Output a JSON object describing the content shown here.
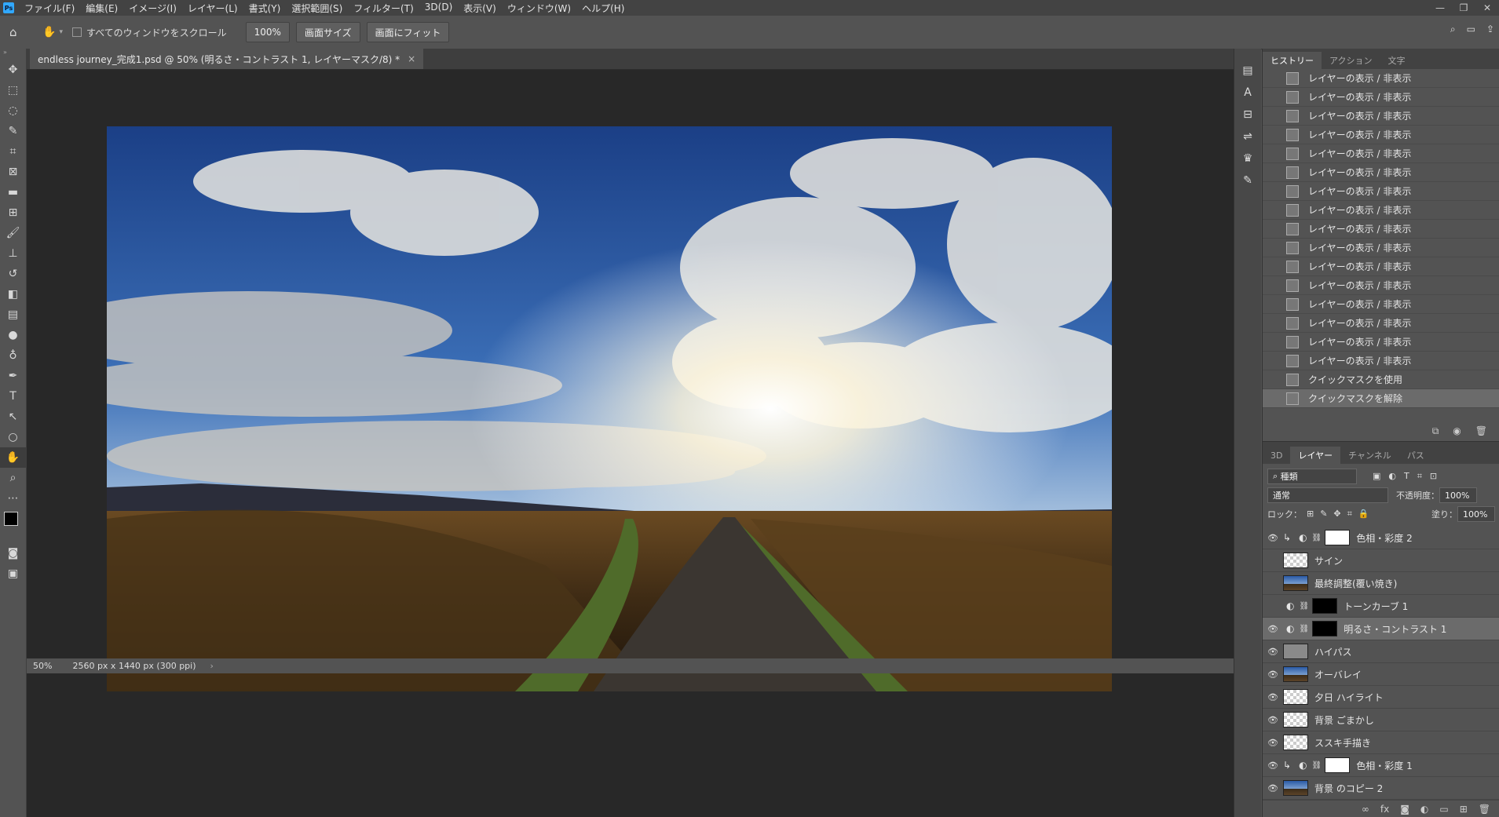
{
  "menubar": {
    "logo": "Ps",
    "items": [
      "ファイル(F)",
      "編集(E)",
      "イメージ(I)",
      "レイヤー(L)",
      "書式(Y)",
      "選択範囲(S)",
      "フィルター(T)",
      "3D(D)",
      "表示(V)",
      "ウィンドウ(W)",
      "ヘルプ(H)"
    ],
    "window_controls": [
      "—",
      "❐",
      "✕"
    ]
  },
  "options": {
    "scroll_all_label": "すべてのウィンドウをスクロール",
    "zoom": "100%",
    "fit_screen": "画面サイズ",
    "fill_screen": "画面にフィット"
  },
  "document": {
    "tab_title": "endless journey_完成1.psd @ 50% (明るさ・コントラスト 1, レイヤーマスク/8) *",
    "status_zoom": "50%",
    "status_info": "2560 px x 1440 px (300 ppi)"
  },
  "history": {
    "tabs": [
      "ヒストリー",
      "アクション",
      "文字"
    ],
    "items": [
      "レイヤーの表示 / 非表示",
      "レイヤーの表示 / 非表示",
      "レイヤーの表示 / 非表示",
      "レイヤーの表示 / 非表示",
      "レイヤーの表示 / 非表示",
      "レイヤーの表示 / 非表示",
      "レイヤーの表示 / 非表示",
      "レイヤーの表示 / 非表示",
      "レイヤーの表示 / 非表示",
      "レイヤーの表示 / 非表示",
      "レイヤーの表示 / 非表示",
      "レイヤーの表示 / 非表示",
      "レイヤーの表示 / 非表示",
      "レイヤーの表示 / 非表示",
      "レイヤーの表示 / 非表示",
      "レイヤーの表示 / 非表示",
      "クイックマスクを使用",
      "クイックマスクを解除"
    ]
  },
  "layers_panel": {
    "tabs": [
      "3D",
      "レイヤー",
      "チャンネル",
      "パス"
    ],
    "filter": "種類",
    "blend_mode": "通常",
    "opacity_label": "不透明度：",
    "opacity": "100%",
    "lock_label": "ロック：",
    "fill_label": "塗り：",
    "fill": "100%",
    "layers": [
      {
        "name": "色相・彩度 2",
        "visible": true,
        "thumb": "white",
        "adjust": true,
        "clip": true
      },
      {
        "name": "サイン",
        "visible": false,
        "thumb": "checker"
      },
      {
        "name": "最終調整(覆い焼き)",
        "visible": false,
        "thumb": "photo"
      },
      {
        "name": "トーンカーブ 1",
        "visible": false,
        "thumb": "black",
        "adjust": true
      },
      {
        "name": "明るさ・コントラスト 1",
        "visible": true,
        "thumb": "black",
        "adjust": true,
        "selected": true
      },
      {
        "name": "ハイパス",
        "visible": true,
        "thumb": "gray"
      },
      {
        "name": "オーバレイ",
        "visible": true,
        "thumb": "photo"
      },
      {
        "name": "夕日 ハイライト",
        "visible": true,
        "thumb": "checker"
      },
      {
        "name": "背景 ごまかし",
        "visible": true,
        "thumb": "checker"
      },
      {
        "name": "ススキ手描き",
        "visible": true,
        "thumb": "checker"
      },
      {
        "name": "色相・彩度 1",
        "visible": true,
        "thumb": "white",
        "adjust": true,
        "clip": true
      },
      {
        "name": "背景 のコピー 2",
        "visible": true,
        "thumb": "photo"
      }
    ]
  },
  "colors": {
    "ui_bg": "#535353",
    "canvas_bg": "#282828",
    "selection": "#6b6b6b"
  }
}
